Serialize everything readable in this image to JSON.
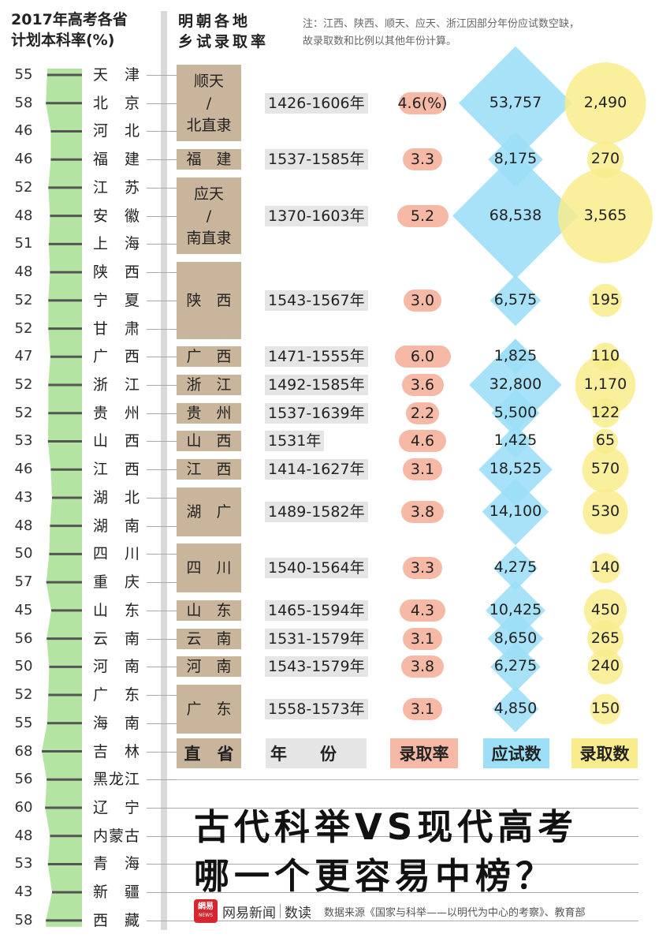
{
  "header": {
    "left_line1": "2017年高考各省",
    "left_line2": "计划本科率(%)",
    "mid_line1": "明朝各地",
    "mid_line2": "乡试录取率",
    "note_line1": "注：江西、陕西、顺天、应天、浙江因部分年份应试数空缺，",
    "note_line2": "故录取数和比例以其他年份计算。"
  },
  "colors": {
    "strip_green": "#b4e4a2",
    "ming_box": "#c9b59b",
    "rate_pink": "#f5b9a6",
    "exam_blue": "#9ddff7",
    "admit_yellow": "#f8ec8c",
    "overlap_green": "#74c46a",
    "year_gray": "#e5e5e5"
  },
  "chart_data": [
    {
      "type": "line",
      "title": "2017年高考各省计划本科率(%)",
      "categories": [
        "天津",
        "北京",
        "河北",
        "福建",
        "江苏",
        "安徽",
        "上海",
        "陕西",
        "宁夏",
        "甘肃",
        "广西",
        "浙江",
        "贵州",
        "山西",
        "江西",
        "湖北",
        "湖南",
        "四川",
        "重庆",
        "山东",
        "云南",
        "河南",
        "广东",
        "海南",
        "吉林",
        "黑龙江",
        "辽宁",
        "内蒙古",
        "青海",
        "新疆",
        "西藏"
      ],
      "labels": [
        "天　津",
        "北　京",
        "河　北",
        "福　建",
        "江　苏",
        "安　徽",
        "上　海",
        "陕　西",
        "宁　夏",
        "甘　肃",
        "广　西",
        "浙　江",
        "贵　州",
        "山　西",
        "江　西",
        "湖　北",
        "湖　南",
        "四　川",
        "重　庆",
        "山　东",
        "云　南",
        "河　南",
        "广　东",
        "海　南",
        "吉　林",
        "黑龙江",
        "辽　宁",
        "内蒙古",
        "青　海",
        "新　疆",
        "西　藏"
      ],
      "values": [
        55,
        58,
        46,
        46,
        52,
        48,
        51,
        48,
        52,
        52,
        47,
        52,
        52,
        53,
        46,
        43,
        48,
        50,
        57,
        45,
        56,
        50,
        52,
        55,
        68,
        56,
        60,
        48,
        53,
        43,
        58
      ],
      "value_labels": [
        "55",
        "58",
        "46",
        "46",
        "52",
        "48",
        "51",
        "48",
        "52",
        "52",
        "47",
        "52",
        "52",
        "53",
        "46",
        "43",
        "48",
        "50",
        "57",
        "45",
        "56",
        "50",
        "52",
        "55",
        "68",
        "56",
        "60",
        "48",
        "53",
        "43",
        "58"
      ]
    },
    {
      "type": "table",
      "title": "明朝各地乡试录取率",
      "columns": [
        "直省",
        "年　　份",
        "录取率",
        "应试数",
        "录取数"
      ],
      "rows": [
        {
          "region": "顺天\n/\n北直隶",
          "years": "1426-1606年",
          "rate": 4.6,
          "rate_label": "4.6(%)",
          "examinees": 53757,
          "examinees_label": "53,757",
          "admitted": 2490,
          "admitted_label": "2,490"
        },
        {
          "region": "福　建",
          "years": "1537-1585年",
          "rate": 3.3,
          "rate_label": "3.3",
          "examinees": 8175,
          "examinees_label": "8,175",
          "admitted": 270,
          "admitted_label": "270"
        },
        {
          "region": "应天\n/\n南直隶",
          "years": "1370-1603年",
          "rate": 5.2,
          "rate_label": "5.2",
          "examinees": 68538,
          "examinees_label": "68,538",
          "admitted": 3565,
          "admitted_label": "3,565"
        },
        {
          "region": "陕　西",
          "years": "1543-1567年",
          "rate": 3.0,
          "rate_label": "3.0",
          "examinees": 6575,
          "examinees_label": "6,575",
          "admitted": 195,
          "admitted_label": "195"
        },
        {
          "region": "广　西",
          "years": "1471-1555年",
          "rate": 6.0,
          "rate_label": "6.0",
          "examinees": 1825,
          "examinees_label": "1,825",
          "admitted": 110,
          "admitted_label": "110"
        },
        {
          "region": "浙　江",
          "years": "1492-1585年",
          "rate": 3.6,
          "rate_label": "3.6",
          "examinees": 32800,
          "examinees_label": "32,800",
          "admitted": 1170,
          "admitted_label": "1,170"
        },
        {
          "region": "贵　州",
          "years": "1537-1639年",
          "rate": 2.2,
          "rate_label": "2.2",
          "examinees": 5500,
          "examinees_label": "5,500",
          "admitted": 122,
          "admitted_label": "122"
        },
        {
          "region": "山　西",
          "years": "1531年",
          "rate": 4.6,
          "rate_label": "4.6",
          "examinees": 1425,
          "examinees_label": "1,425",
          "admitted": 65,
          "admitted_label": "65"
        },
        {
          "region": "江　西",
          "years": "1414-1627年",
          "rate": 3.1,
          "rate_label": "3.1",
          "examinees": 18525,
          "examinees_label": "18,525",
          "admitted": 570,
          "admitted_label": "570"
        },
        {
          "region": "湖　广",
          "years": "1489-1582年",
          "rate": 3.8,
          "rate_label": "3.8",
          "examinees": 14100,
          "examinees_label": "14,100",
          "admitted": 530,
          "admitted_label": "530"
        },
        {
          "region": "四　川",
          "years": "1540-1564年",
          "rate": 3.3,
          "rate_label": "3.3",
          "examinees": 4275,
          "examinees_label": "4,275",
          "admitted": 140,
          "admitted_label": "140"
        },
        {
          "region": "山　东",
          "years": "1465-1594年",
          "rate": 4.3,
          "rate_label": "4.3",
          "examinees": 10425,
          "examinees_label": "10,425",
          "admitted": 450,
          "admitted_label": "450"
        },
        {
          "region": "云　南",
          "years": "1531-1579年",
          "rate": 3.1,
          "rate_label": "3.1",
          "examinees": 8650,
          "examinees_label": "8,650",
          "admitted": 265,
          "admitted_label": "265"
        },
        {
          "region": "河　南",
          "years": "1543-1579年",
          "rate": 3.8,
          "rate_label": "3.8",
          "examinees": 6275,
          "examinees_label": "6,275",
          "admitted": 240,
          "admitted_label": "240"
        },
        {
          "region": "广　东",
          "years": "1558-1573年",
          "rate": 3.1,
          "rate_label": "3.1",
          "examinees": 4850,
          "examinees_label": "4,850",
          "admitted": 150,
          "admitted_label": "150"
        }
      ]
    }
  ],
  "legend": {
    "region": "直　省",
    "years": "年　　份",
    "rate": "录取率",
    "examinees": "应试数",
    "admitted": "录取数"
  },
  "title": {
    "line1": "古代科举VS现代高考",
    "line2": "哪一个更容易中榜？"
  },
  "footer": {
    "logo_text": "網易",
    "logo_sub": "NEWS",
    "brand": "网易新闻",
    "brand2": "数读",
    "source": "数据来源《国家与科举——以明代为中心的考察》、教育部"
  }
}
